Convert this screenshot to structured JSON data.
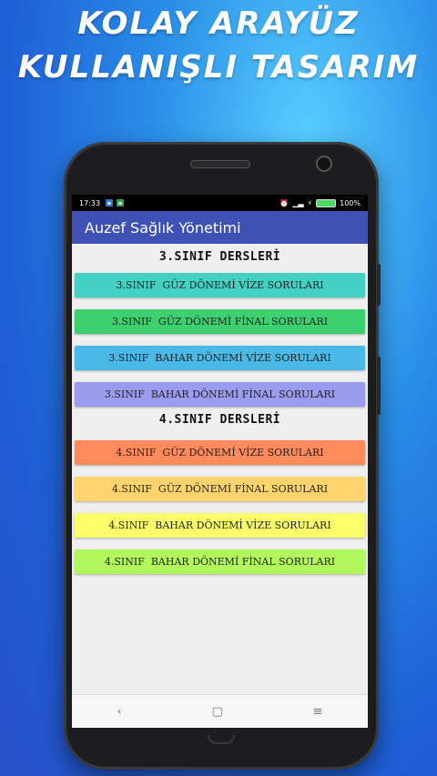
{
  "promo": {
    "line1": "KOLAY ARAYÜZ",
    "line2": "KULLANIŞLI TASARIM"
  },
  "status_bar": {
    "time": "17:33",
    "battery_text": "100%",
    "icons": [
      "notification-icon",
      "notification-icon",
      "alarm-icon",
      "signal-icon",
      "charging-icon",
      "battery-icon"
    ]
  },
  "app": {
    "title": "Auzef Sağlık Yönetimi"
  },
  "sections": [
    {
      "title": "3.SINIF DERSLERİ",
      "items": [
        {
          "label": "3.SINIF  GÜZ DÖNEMİ VİZE SORULARI",
          "color": "#44d1c4"
        },
        {
          "label": "3.SINIF  GÜZ DÖNEMİ FİNAL SORULARI",
          "color": "#3ecf6e"
        },
        {
          "label": "3.SINIF  BAHAR DÖNEMİ VİZE SORULARI",
          "color": "#4ab9e8"
        },
        {
          "label": "3.SINIF  BAHAR DÖNEMİ FİNAL SORULARI",
          "color": "#9c9cef"
        }
      ]
    },
    {
      "title": "4.SINIF DERSLERİ",
      "items": [
        {
          "label": "4.SINIF  GÜZ DÖNEMİ VİZE SORULARI",
          "color": "#ff8a5c"
        },
        {
          "label": "4.SINIF  GÜZ DÖNEMİ FİNAL SORULARI",
          "color": "#ffd46e"
        },
        {
          "label": "4.SINIF  BAHAR DÖNEMİ VİZE SORULARI",
          "color": "#fbff6a"
        },
        {
          "label": "4.SINIF  BAHAR DÖNEMİ FİNAL SORULARI",
          "color": "#b3f75f"
        }
      ]
    }
  ],
  "navbar": {
    "back": "‹",
    "home": "▢",
    "recents": "≡"
  }
}
